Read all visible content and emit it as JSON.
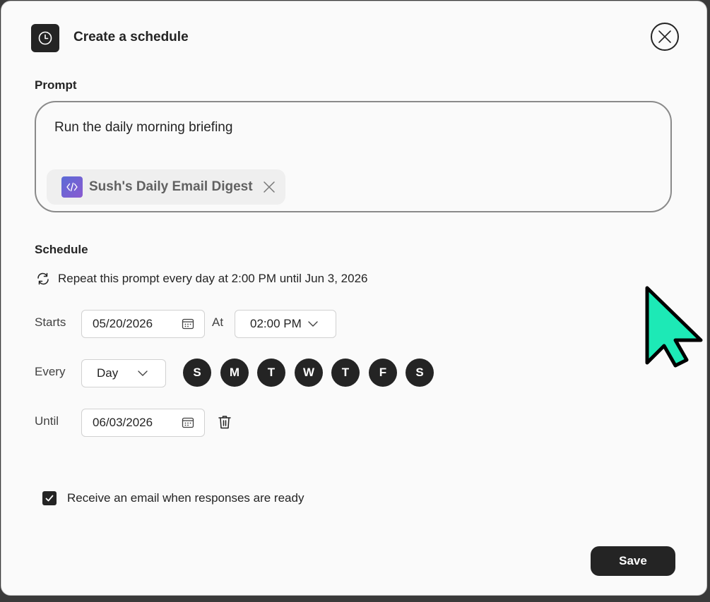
{
  "header": {
    "title": "Create a schedule",
    "icon": "clock-icon",
    "close_icon": "close-icon"
  },
  "prompt": {
    "label": "Prompt",
    "text": "Run the daily morning briefing",
    "attachment": {
      "label": "Sush's Daily Email Digest",
      "icon": "code-app-icon",
      "remove_icon": "close-icon"
    }
  },
  "schedule": {
    "label": "Schedule",
    "summary": "Repeat this prompt every day at 2:00 PM until Jun 3, 2026",
    "starts_label": "Starts",
    "starts_value": "05/20/2026",
    "at_label": "At",
    "at_value": "02:00 PM",
    "every_label": "Every",
    "every_value": "Day",
    "days": [
      "S",
      "M",
      "T",
      "W",
      "T",
      "F",
      "S"
    ],
    "until_label": "Until",
    "until_value": "06/03/2026"
  },
  "email_option": {
    "label": "Receive an email when responses are ready",
    "checked": true
  },
  "footer": {
    "save_label": "Save"
  },
  "colors": {
    "accent_dark": "#242424",
    "cursor_fill": "#1de9b6",
    "chip_gradient_start": "#5b6bd6",
    "chip_gradient_end": "#8a5ad0"
  }
}
